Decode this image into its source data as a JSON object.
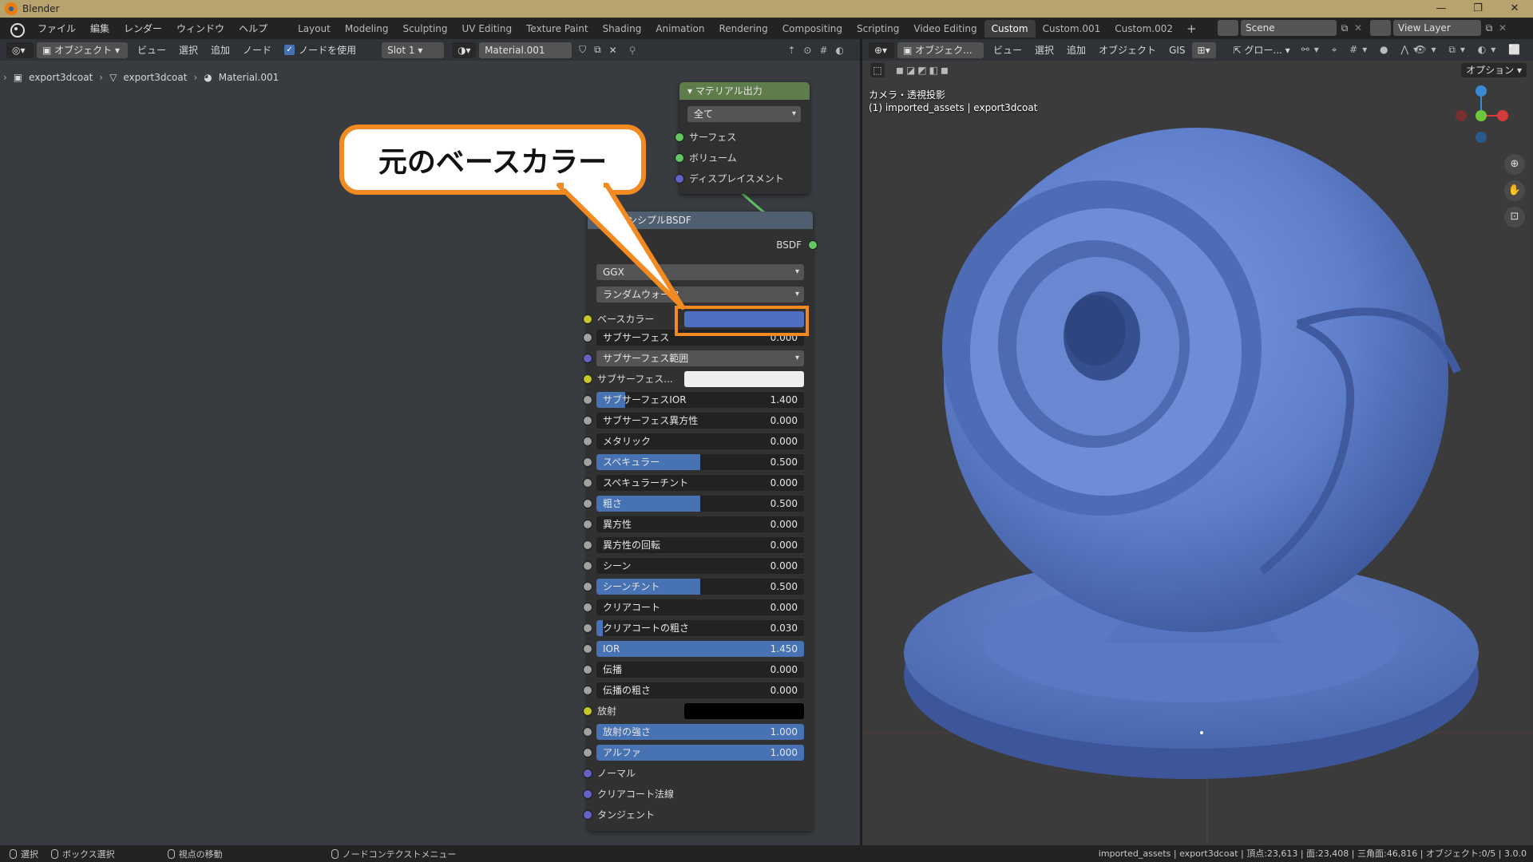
{
  "window": {
    "title": "Blender",
    "controls": [
      "—",
      "❐",
      "✕"
    ]
  },
  "menubar": {
    "items": [
      "ファイル",
      "編集",
      "レンダー",
      "ウィンドウ",
      "ヘルプ"
    ],
    "workspaces": [
      "Layout",
      "Modeling",
      "Sculpting",
      "UV Editing",
      "Texture Paint",
      "Shading",
      "Animation",
      "Rendering",
      "Compositing",
      "Scripting",
      "Video Editing",
      "Custom",
      "Custom.001",
      "Custom.002"
    ],
    "active_workspace": "Custom",
    "add_tab": "+",
    "scene": "Scene",
    "view_layer": "View Layer"
  },
  "node_editor": {
    "header": {
      "mode": "オブジェクト",
      "menus": [
        "ビュー",
        "選択",
        "追加",
        "ノード"
      ],
      "use_nodes_label": "ノードを使用",
      "slot": "Slot 1",
      "material": "Material.001"
    },
    "breadcrumb": [
      "export3dcoat",
      "export3dcoat",
      "Material.001"
    ],
    "output_node": {
      "title": "マテリアル出力",
      "target": "全て",
      "sockets": [
        "サーフェス",
        "ボリューム",
        "ディスプレイスメント"
      ]
    },
    "bsdf_node": {
      "title": "プリンシプルBSDF",
      "output": "BSDF",
      "distribution": "GGX",
      "subsurface_method": "ランダムウォーク",
      "base_color_label": "ベースカラー",
      "base_color": "#4f6fc3",
      "rows": [
        {
          "label": "サブサーフェス",
          "value": "0.000",
          "fill": 0
        },
        {
          "label": "サブサーフェス範囲",
          "dropdown": true
        },
        {
          "label": "サブサーフェス...",
          "color": "#eeeeee"
        },
        {
          "label": "サブサーフェスIOR",
          "value": "1.400",
          "fill": 0.14
        },
        {
          "label": "サブサーフェス異方性",
          "value": "0.000",
          "fill": 0
        },
        {
          "label": "メタリック",
          "value": "0.000",
          "fill": 0
        },
        {
          "label": "スペキュラー",
          "value": "0.500",
          "fill": 0.5
        },
        {
          "label": "スペキュラーチント",
          "value": "0.000",
          "fill": 0
        },
        {
          "label": "粗さ",
          "value": "0.500",
          "fill": 0.5
        },
        {
          "label": "異方性",
          "value": "0.000",
          "fill": 0
        },
        {
          "label": "異方性の回転",
          "value": "0.000",
          "fill": 0
        },
        {
          "label": "シーン",
          "value": "0.000",
          "fill": 0
        },
        {
          "label": "シーンチント",
          "value": "0.500",
          "fill": 0.5
        },
        {
          "label": "クリアコート",
          "value": "0.000",
          "fill": 0
        },
        {
          "label": "クリアコートの粗さ",
          "value": "0.030",
          "fill": 0.03
        },
        {
          "label": "IOR",
          "value": "1.450",
          "fill": 1
        },
        {
          "label": "伝播",
          "value": "0.000",
          "fill": 0
        },
        {
          "label": "伝播の粗さ",
          "value": "0.000",
          "fill": 0
        },
        {
          "label": "放射",
          "color": "#000000"
        },
        {
          "label": "放射の強さ",
          "value": "1.000",
          "fill": 1
        },
        {
          "label": "アルファ",
          "value": "1.000",
          "fill": 1
        }
      ],
      "vector_inputs": [
        "ノーマル",
        "クリアコート法線",
        "タンジェント"
      ]
    },
    "callout": "元のベースカラー"
  },
  "viewport": {
    "header": {
      "mode": "オブジェク...",
      "menus": [
        "ビュー",
        "選択",
        "追加",
        "オブジェクト",
        "GIS"
      ],
      "transform": "グロー...",
      "options": "オプション"
    },
    "overlay_title": "カメラ・透視投影",
    "overlay_subtitle": "(1) imported_assets | export3dcoat",
    "model_color": "#5f7fcb"
  },
  "statusbar": {
    "items": [
      "選択",
      "ボックス選択",
      "視点の移動",
      "ノードコンテクストメニュー"
    ],
    "stats": "imported_assets | export3dcoat | 頂点:23,613 | 面:23,408 | 三角面:46,816 | オブジェクト:0/5 | 3.0.0"
  }
}
